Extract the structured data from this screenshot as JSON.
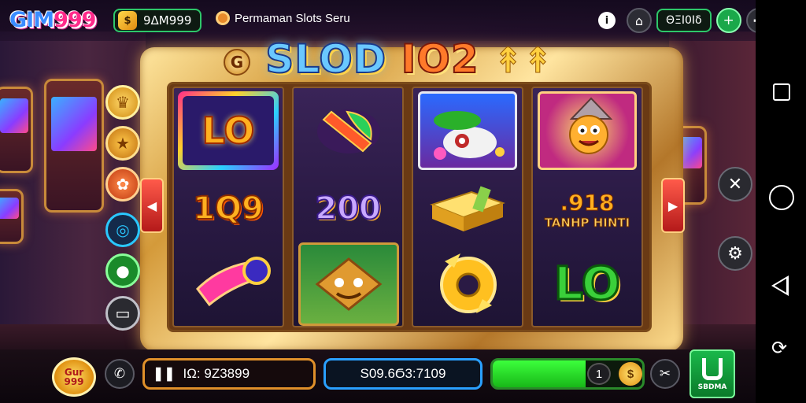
{
  "header": {
    "logo_main": "GIM",
    "logo_num": "999",
    "coin_icon": "coin-icon",
    "coin_balance": "9ΔM999",
    "game_name": "Permaman Slots Seru",
    "info_icon": "info-icon",
    "camera_icon": "camera-icon",
    "account_code": "ΘΞΙ0Ιδ",
    "add_icon": "plus-icon"
  },
  "headline": {
    "badge": "G",
    "part1": "SLOD",
    "part2": "IO2",
    "part3": "↟↟"
  },
  "reels": [
    {
      "symbols": [
        {
          "kind": "text-tile",
          "text": "LO"
        },
        {
          "kind": "text",
          "text": "1Q9"
        },
        {
          "kind": "icon",
          "text": "gem-bar-icon"
        }
      ]
    },
    {
      "symbols": [
        {
          "kind": "icon",
          "text": "leaf-icon"
        },
        {
          "kind": "text",
          "text": "200"
        },
        {
          "kind": "icon",
          "text": "jungle-mask-icon"
        }
      ]
    },
    {
      "symbols": [
        {
          "kind": "icon",
          "text": "ghost-hat-icon"
        },
        {
          "kind": "icon",
          "text": "gold-bars-icon"
        },
        {
          "kind": "icon",
          "text": "gold-ring-icon"
        }
      ]
    },
    {
      "symbols": [
        {
          "kind": "icon",
          "text": "wizard-mascot-icon"
        },
        {
          "kind": "text",
          "text": ".918",
          "sub": "TANHP HINTI"
        },
        {
          "kind": "text",
          "text": "LO"
        }
      ]
    }
  ],
  "bottom": {
    "chip_line1": "Gur",
    "chip_line2": "999",
    "balance_label": "ΙΩ: 9Ζ3899",
    "win_label": "S09.6Ϭ3:7109",
    "bet_value": "1",
    "bet_fill_fraction": 0.62,
    "spin_label": "SBDMA"
  },
  "colors": {
    "accent_green": "#2ec76a",
    "gold": "#e0902a",
    "win_blue": "#2aa0ff"
  }
}
